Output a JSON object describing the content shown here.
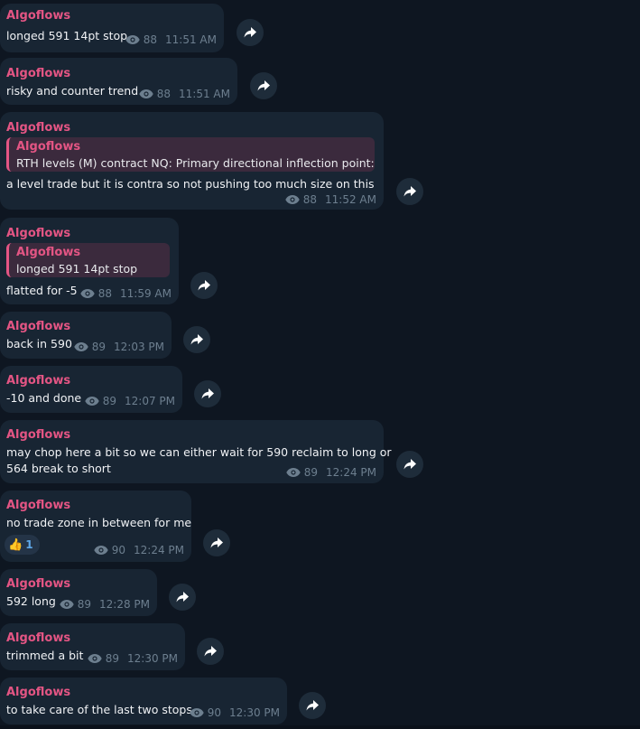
{
  "channel": {
    "sender_color": "#e45584",
    "bubble_color": "#182533",
    "background_color": "#0e1621"
  },
  "messages": [
    {
      "sender": "Algoflows",
      "text": "longed 591 14pt stop",
      "views": "88",
      "time": "11:51 AM"
    },
    {
      "sender": "Algoflows",
      "text": "risky and counter trend",
      "views": "88",
      "time": "11:51 AM"
    },
    {
      "sender": "Algoflows",
      "reply_sender": "Algoflows",
      "reply_text": "RTH levels (M) contract  NQ:  Primary directional inflection point:...",
      "text": "a level trade but it is contra so not pushing too much size on this",
      "views": "88",
      "time": "11:52 AM"
    },
    {
      "sender": "Algoflows",
      "reply_sender": "Algoflows",
      "reply_text": "longed 591 14pt stop",
      "text": "flatted for -5",
      "views": "88",
      "time": "11:59 AM"
    },
    {
      "sender": "Algoflows",
      "text": "back in 590",
      "views": "89",
      "time": "12:03 PM"
    },
    {
      "sender": "Algoflows",
      "text": "-10 and done",
      "views": "89",
      "time": "12:07 PM"
    },
    {
      "sender": "Algoflows",
      "text_line1": "may chop here a bit so we can either wait for 590 reclaim to long or",
      "text_line2": "564 break to short",
      "views": "89",
      "time": "12:24 PM"
    },
    {
      "sender": "Algoflows",
      "text": "no trade zone in between for me",
      "reaction_emoji": "👍",
      "reaction_count": "1",
      "views": "90",
      "time": "12:24 PM"
    },
    {
      "sender": "Algoflows",
      "text": "592 long",
      "views": "89",
      "time": "12:28 PM"
    },
    {
      "sender": "Algoflows",
      "text": "trimmed a bit",
      "views": "89",
      "time": "12:30 PM"
    },
    {
      "sender": "Algoflows",
      "text": "to take care of the last two stops",
      "views": "90",
      "time": "12:30 PM"
    }
  ]
}
